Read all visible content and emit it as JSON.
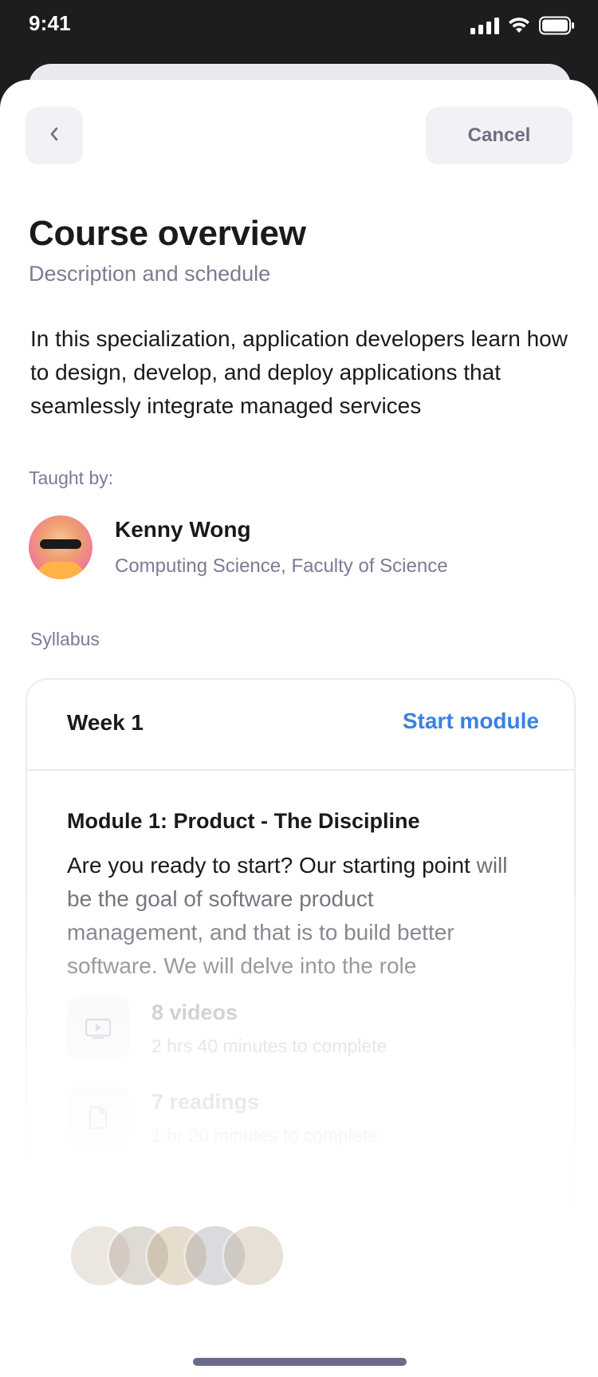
{
  "status_bar": {
    "time": "9:41"
  },
  "header": {
    "back_icon": "chevron-left-icon",
    "cancel_label": "Cancel"
  },
  "course": {
    "title": "Course overview",
    "subtitle": "Description and schedule",
    "description": "In this specialization, application developers learn how to design, develop, and deploy applications that seamlessly integrate managed services"
  },
  "instructor": {
    "taught_by_label": "Taught by:",
    "name": "Kenny Wong",
    "department": "Computing Science, Faculty of Science"
  },
  "syllabus": {
    "label": "Syllabus",
    "week": {
      "label": "Week 1",
      "action_label": "Start module",
      "module_title": "Module 1: Product - The Discipline",
      "description_first": "Are you ready to start? Our starting point",
      "description_rest": "will be the goal of software product management, and that is to build better software. We will delve into the role",
      "resources": [
        {
          "icon": "video-icon",
          "title": "8 videos",
          "subtitle": "2 hrs 40 minutes to complete"
        },
        {
          "icon": "document-icon",
          "title": "7 readings",
          "subtitle": "1 hr 20 minutes to complete"
        }
      ]
    }
  },
  "colors": {
    "accent": "#3b82e0",
    "text_primary": "#1a1a1e",
    "text_secondary": "#7b7b94",
    "button_bg": "#f1f1f6"
  }
}
